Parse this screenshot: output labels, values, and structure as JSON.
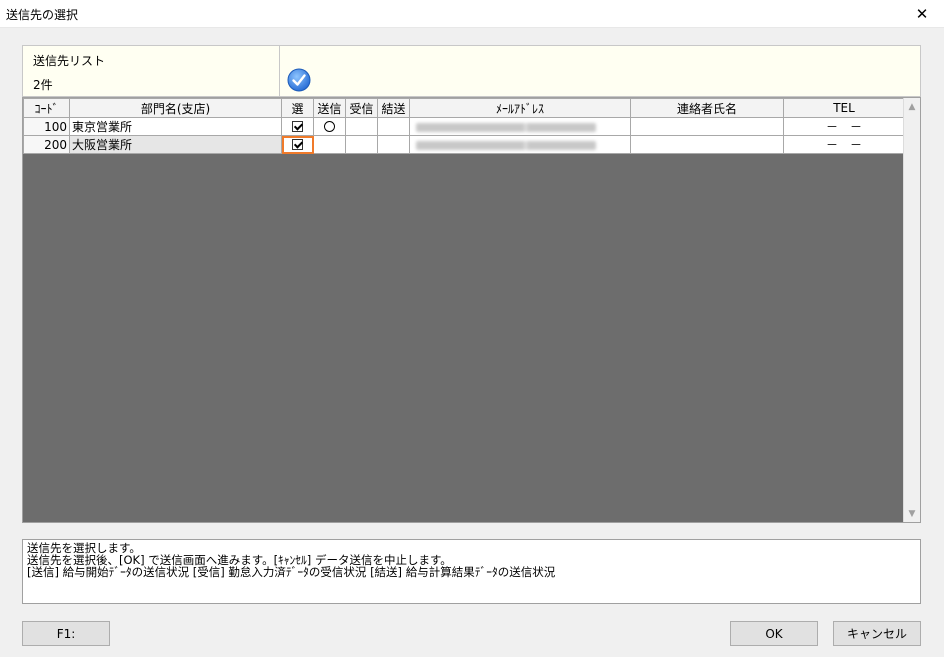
{
  "window": {
    "title": "送信先の選択"
  },
  "header": {
    "list_title": "送信先リスト",
    "count": "2件"
  },
  "table": {
    "columns": [
      "ｺｰﾄﾞ",
      "部門名(支店)",
      "選",
      "送信",
      "受信",
      "結送",
      "ﾒｰﾙｱﾄﾞﾚｽ",
      "連絡者氏名",
      "TEL"
    ],
    "rows": [
      {
        "code": "100",
        "dept": "東京営業所",
        "selected": true,
        "send": "○",
        "recv": "",
        "result": "",
        "contact": "",
        "tel": "－　－"
      },
      {
        "code": "200",
        "dept": "大阪営業所",
        "selected": true,
        "send": "",
        "recv": "",
        "result": "",
        "contact": "",
        "tel": "－　－"
      }
    ]
  },
  "description": {
    "line1": "送信先を選択します。",
    "line2": "送信先を選択後、[OK] で送信画面へ進みます。[ｷｬﾝｾﾙ] データ送信を中止します。",
    "line3": "[送信] 給与開始ﾃﾞｰﾀの送信状況 [受信] 勤怠入力済ﾃﾞｰﾀの受信状況 [結送] 給与計算結果ﾃﾞｰﾀの送信状況"
  },
  "buttons": {
    "f1": "F1:",
    "ok": "OK",
    "cancel": "キャンセル"
  },
  "icons": {
    "close": "close-icon",
    "confirm": "check-circle-icon"
  },
  "colors": {
    "header_bg": "#fffff2",
    "grid_bg": "#6d6d6d",
    "focus": "#f07a2a",
    "check_icon": "#2a6fd6"
  }
}
